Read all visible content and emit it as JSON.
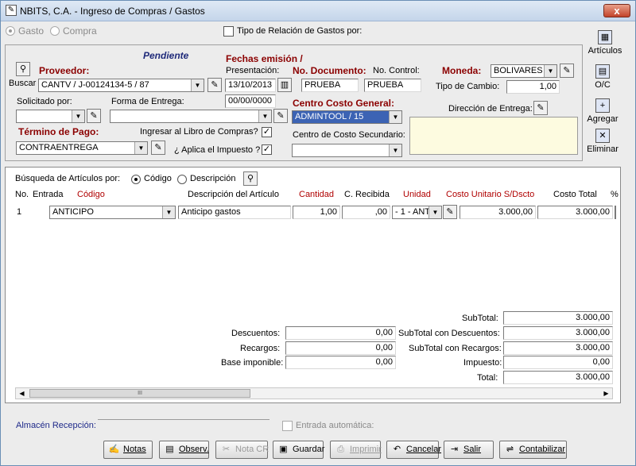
{
  "window": {
    "title": "NBITS, C.A. - Ingreso de Compras / Gastos",
    "close": "x"
  },
  "top": {
    "gasto": "Gasto",
    "compra": "Compra",
    "tipo_relacion": "Tipo de Relación de Gastos por:"
  },
  "status": "Pendiente",
  "proveedor": {
    "label": "Proveedor:",
    "buscar": "Buscar",
    "value": "CANTV / J-00124134-5 / 87"
  },
  "fechas": {
    "label": "Fechas emisión /",
    "presentacion_label": "Presentación:",
    "presentacion": "13/10/2013",
    "fecha2": "00/00/0000"
  },
  "documento": {
    "label": "No. Documento:",
    "value": "PRUEBA",
    "control_label": "No. Control:",
    "control": "PRUEBA"
  },
  "moneda": {
    "label": "Moneda:",
    "value": "BOLIVARES",
    "tipo_cambio_label": "Tipo de Cambio:",
    "tipo_cambio": "1,00"
  },
  "solicitado": {
    "label": "Solicitado por:",
    "value": ""
  },
  "forma_entrega": {
    "label": "Forma de Entrega:",
    "value": ""
  },
  "centro_costo": {
    "label": "Centro Costo General:",
    "value": "ADMINTOOL / 15",
    "sec_label": "Centro de Costo Secundario:",
    "sec_value": ""
  },
  "direccion": {
    "label": "Dirección de Entrega:",
    "value": ""
  },
  "termino": {
    "label": "Término de Pago:",
    "value": "CONTRAENTREGA"
  },
  "libro": {
    "label": "Ingresar al Libro de Compras?",
    "check": "✓"
  },
  "impuesto": {
    "label": "¿ Aplica el Impuesto ?",
    "check": "✓"
  },
  "sidebar": {
    "articulos": "Artículos",
    "oc": "O/C",
    "agregar": "Agregar",
    "eliminar": "Eliminar"
  },
  "busqueda": {
    "label": "Búsqueda de Artículos por:",
    "codigo": "Código",
    "descripcion": "Descripción"
  },
  "table": {
    "headers": {
      "no": "No.",
      "entrada": "Entrada",
      "codigo": "Código",
      "descripcion": "Descripción del Artículo",
      "cantidad": "Cantidad",
      "recibida": "C. Recibida",
      "unidad": "Unidad",
      "costo": "Costo Unitario S/Dscto",
      "total": "Costo Total",
      "pct": "%"
    },
    "rows": [
      {
        "no": "1",
        "codigo": "ANTICIPO",
        "descripcion": "Anticipo gastos",
        "cantidad": "1,00",
        "recibida": ",00",
        "unidad": "- 1 - ANT",
        "costo": "3.000,00",
        "total": "3.000,00"
      }
    ]
  },
  "totals": {
    "descuentos_label": "Descuentos:",
    "descuentos": "0,00",
    "recargos_label": "Recargos:",
    "recargos": "0,00",
    "base_label": "Base imponible:",
    "base": "0,00",
    "subtotal_label": "SubTotal:",
    "subtotal": "3.000,00",
    "sub_desc_label": "SubTotal con Descuentos:",
    "sub_desc": "3.000,00",
    "sub_rec_label": "SubTotal con Recargos:",
    "sub_rec": "3.000,00",
    "impuesto_label": "Impuesto:",
    "impuesto": "0,00",
    "total_label": "Total:",
    "total": "3.000,00"
  },
  "almacen": {
    "label": "Almacén Recepción:",
    "entrada_auto": "Entrada automática:"
  },
  "buttons": {
    "notas": "Notas",
    "observ": "Observ.",
    "nota_cr": "Nota CR",
    "guardar": "Guardar",
    "imprimir": "Imprimir",
    "cancelar": "Cancelar",
    "salir": "Salir",
    "contabilizar": "Contabilizar"
  }
}
